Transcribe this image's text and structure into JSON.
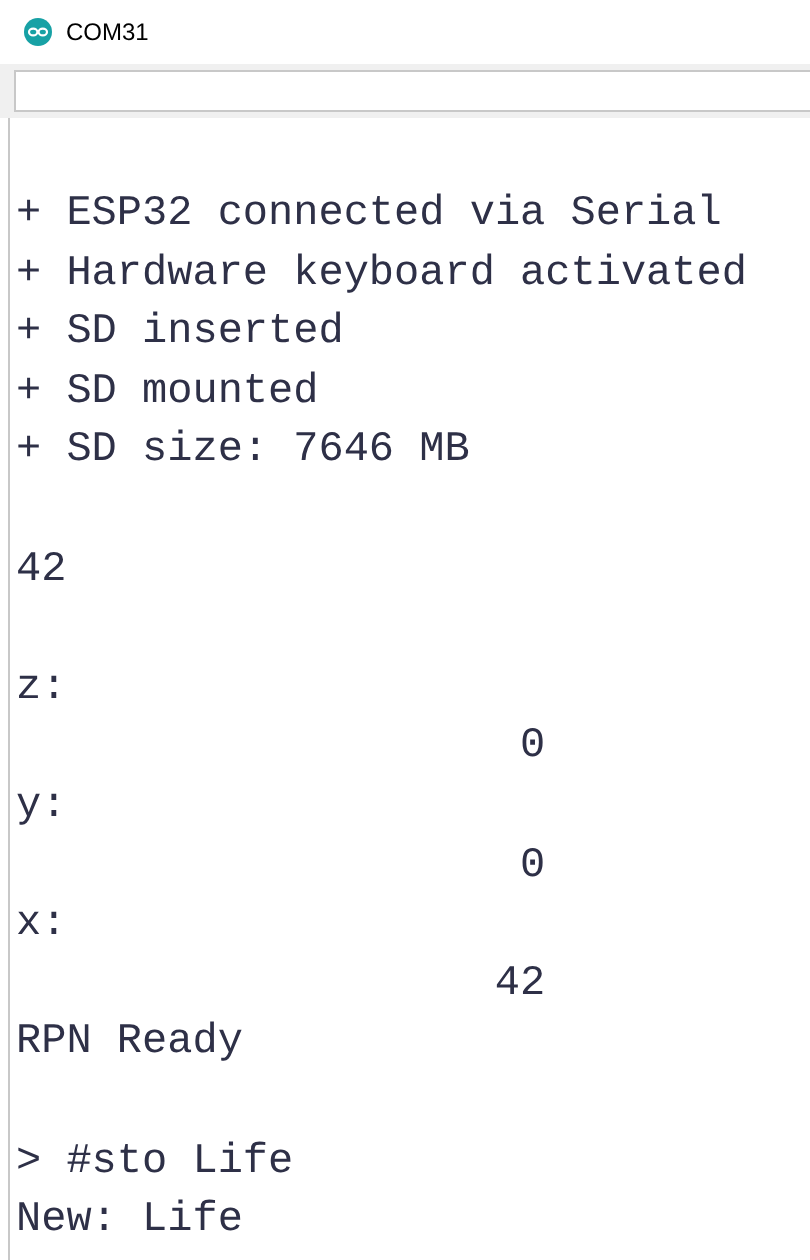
{
  "window": {
    "title": "COM31"
  },
  "output": [
    {
      "kind": "text",
      "text": "+ ESP32 connected via Serial"
    },
    {
      "kind": "text",
      "text": "+ Hardware keyboard activated"
    },
    {
      "kind": "text",
      "text": "+ SD inserted"
    },
    {
      "kind": "text",
      "text": "+ SD mounted"
    },
    {
      "kind": "text",
      "text": "+ SD size: 7646 MB"
    },
    {
      "kind": "blank"
    },
    {
      "kind": "text",
      "text": "42"
    },
    {
      "kind": "blank"
    },
    {
      "kind": "text",
      "text": "z:"
    },
    {
      "kind": "value",
      "text": "0"
    },
    {
      "kind": "text",
      "text": "y:"
    },
    {
      "kind": "value",
      "text": "0"
    },
    {
      "kind": "text",
      "text": "x:"
    },
    {
      "kind": "value",
      "text": "42"
    },
    {
      "kind": "text",
      "text": "RPN Ready"
    },
    {
      "kind": "blank"
    },
    {
      "kind": "text",
      "text": "> #sto Life"
    },
    {
      "kind": "text",
      "text": "New: Life"
    }
  ]
}
